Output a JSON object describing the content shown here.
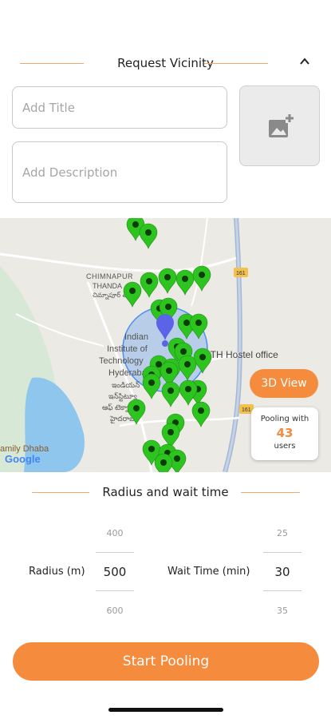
{
  "request_section": {
    "title": "Request Vicinity"
  },
  "form": {
    "title_placeholder": "Add Title",
    "description_placeholder": "Add Description"
  },
  "map": {
    "labels": {
      "area_1": "CHIMNAPUR",
      "area_2": "THANDA",
      "area_telugu": "చిమ్నాపూర్ తండా",
      "institute_1": "Indian",
      "institute_2": "Institute of",
      "institute_3": "Technology",
      "institute_4": "Hyderabad",
      "institute_telugu_1": "ఇండియన్",
      "institute_telugu_2": "ఇన్‌స్టిట్యూ",
      "institute_telugu_3": "ఆఫ్ టెక్నా",
      "institute_telugu_4": "హైదరాబా",
      "hostel": "IITH Hostel office",
      "dhaba": "amily Dhaba",
      "highway_1": "161",
      "highway_2": "161",
      "attribution": "Google"
    },
    "three_d_button": "3D View",
    "pooling": {
      "prefix": "Pooling with",
      "count": "43",
      "suffix": "users"
    },
    "colors": {
      "pin": "#2ec41f",
      "user_pin": "#5b63e6",
      "radius": "#4a8ff0"
    }
  },
  "radius_section": {
    "title": "Radius and wait time"
  },
  "radius_picker": {
    "label": "Radius (m)",
    "prev": "400",
    "value": "500",
    "next": "600"
  },
  "wait_picker": {
    "label": "Wait Time (min)",
    "prev": "25",
    "value": "30",
    "next": "35"
  },
  "start_button": {
    "label": "Start Pooling"
  },
  "accent_color": "#f58b3c"
}
